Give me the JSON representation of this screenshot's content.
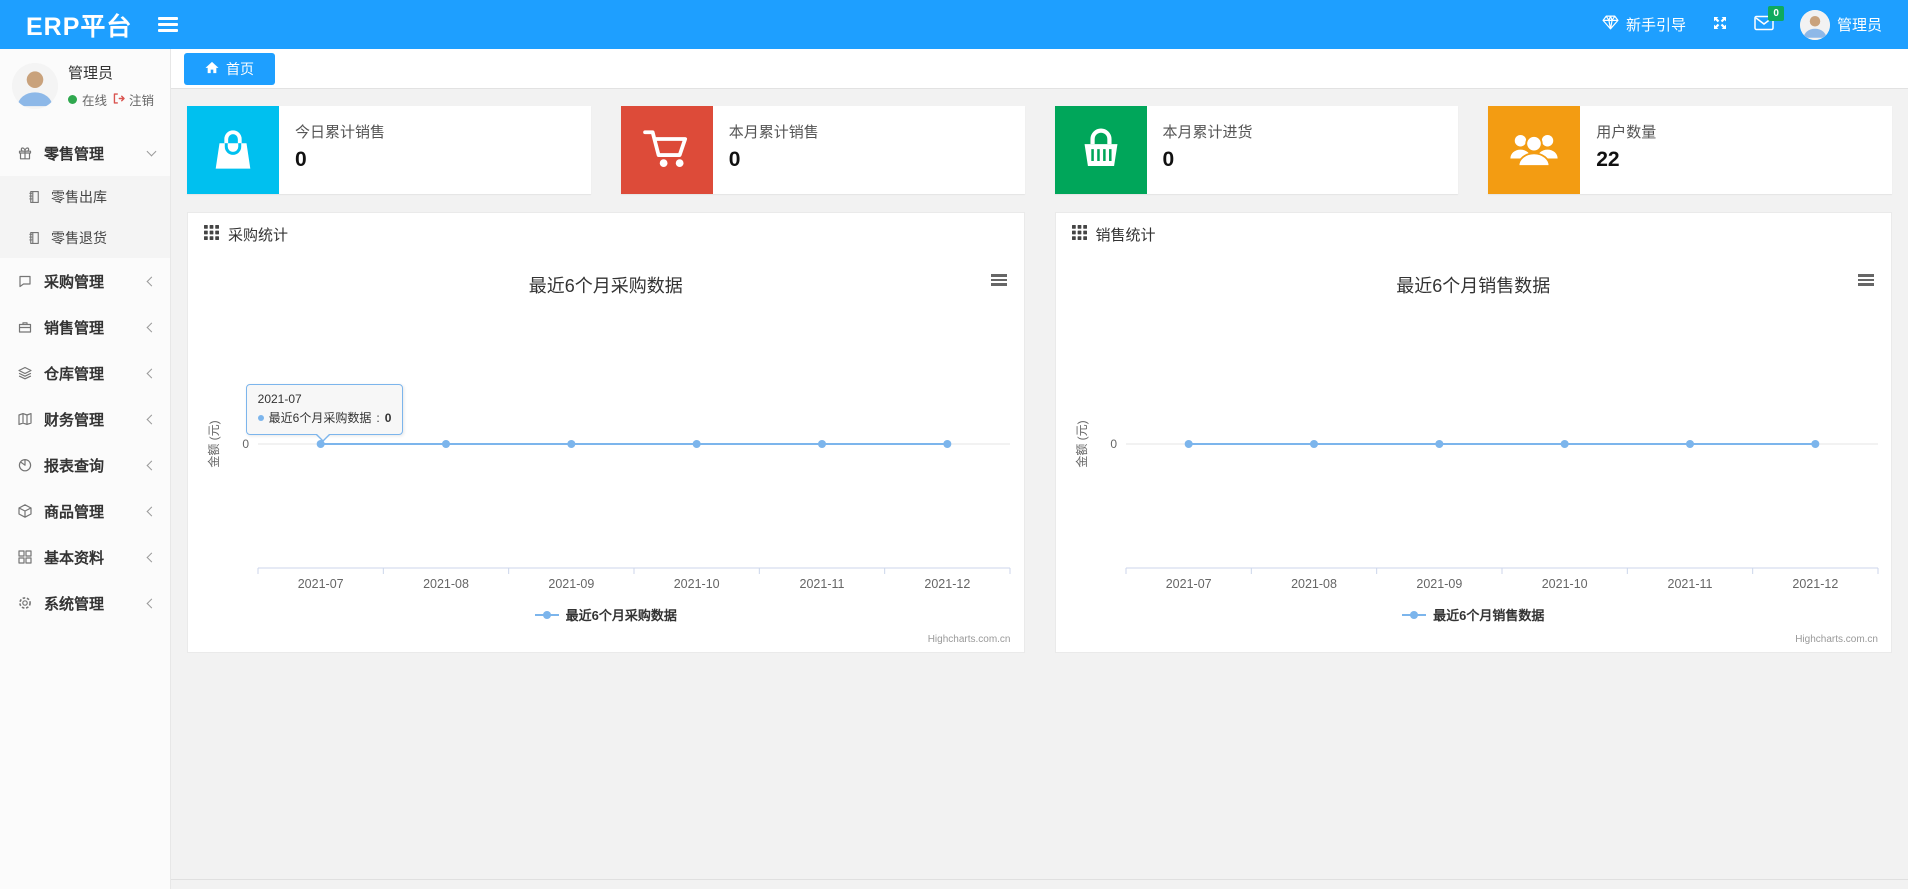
{
  "header": {
    "brand": "ERP平台",
    "guide_label": "新手引导",
    "mail_badge": "0",
    "user_name": "管理员"
  },
  "sidebar": {
    "user": {
      "name": "管理员",
      "status": "在线",
      "logout": "注销"
    },
    "menu": [
      {
        "key": "retail",
        "label": "零售管理",
        "icon": "gift-icon",
        "expanded": true,
        "children": [
          {
            "key": "retail-out",
            "label": "零售出库",
            "icon": "doc-icon"
          },
          {
            "key": "retail-return",
            "label": "零售退货",
            "icon": "doc-icon"
          }
        ]
      },
      {
        "key": "purchase",
        "label": "采购管理",
        "icon": "bubble-icon",
        "expanded": false,
        "children": []
      },
      {
        "key": "sales",
        "label": "销售管理",
        "icon": "briefcase-icon",
        "expanded": false,
        "children": []
      },
      {
        "key": "warehouse",
        "label": "仓库管理",
        "icon": "layers-icon",
        "expanded": false,
        "children": []
      },
      {
        "key": "finance",
        "label": "财务管理",
        "icon": "book-icon",
        "expanded": false,
        "children": []
      },
      {
        "key": "reports",
        "label": "报表查询",
        "icon": "piechart-icon",
        "expanded": false,
        "children": []
      },
      {
        "key": "goods",
        "label": "商品管理",
        "icon": "box-icon",
        "expanded": false,
        "children": []
      },
      {
        "key": "basic",
        "label": "基本资料",
        "icon": "grid-icon",
        "expanded": false,
        "children": []
      },
      {
        "key": "system",
        "label": "系统管理",
        "icon": "gear-icon",
        "expanded": false,
        "children": []
      }
    ]
  },
  "tabs": {
    "home": "首页"
  },
  "stat_cards": [
    {
      "label": "今日累计销售",
      "value": "0",
      "color": "#00c0ef",
      "icon": "shopping-bag-icon"
    },
    {
      "label": "本月累计销售",
      "value": "0",
      "color": "#dd4b39",
      "icon": "shopping-cart-icon"
    },
    {
      "label": "本月累计进货",
      "value": "0",
      "color": "#00a65a",
      "icon": "basket-icon"
    },
    {
      "label": "用户数量",
      "value": "22",
      "color": "#f39c12",
      "icon": "users-icon"
    }
  ],
  "panels": [
    {
      "title": "采购统计"
    },
    {
      "title": "销售统计"
    }
  ],
  "chart_data": [
    {
      "type": "line",
      "title": "最近6个月采购数据",
      "categories": [
        "2021-07",
        "2021-08",
        "2021-09",
        "2021-10",
        "2021-11",
        "2021-12"
      ],
      "series": [
        {
          "name": "最近6个月采购数据",
          "values": [
            0,
            0,
            0,
            0,
            0,
            0
          ]
        }
      ],
      "xlabel": "",
      "ylabel": "金额 (元)",
      "yticks": [
        "0"
      ],
      "ylim": [
        -1,
        1
      ],
      "grid": false,
      "legend_position": "bottom",
      "line_color": "#7cb5ec",
      "credit": "Highcharts.com.cn",
      "tooltip": {
        "date": "2021-07",
        "label": "最近6个月采购数据",
        "value": "0"
      }
    },
    {
      "type": "line",
      "title": "最近6个月销售数据",
      "categories": [
        "2021-07",
        "2021-08",
        "2021-09",
        "2021-10",
        "2021-11",
        "2021-12"
      ],
      "series": [
        {
          "name": "最近6个月销售数据",
          "values": [
            0,
            0,
            0,
            0,
            0,
            0
          ]
        }
      ],
      "xlabel": "",
      "ylabel": "金额 (元)",
      "yticks": [
        "0"
      ],
      "ylim": [
        -1,
        1
      ],
      "grid": false,
      "legend_position": "bottom",
      "line_color": "#7cb5ec",
      "credit": "Highcharts.com.cn",
      "tooltip": null
    }
  ]
}
